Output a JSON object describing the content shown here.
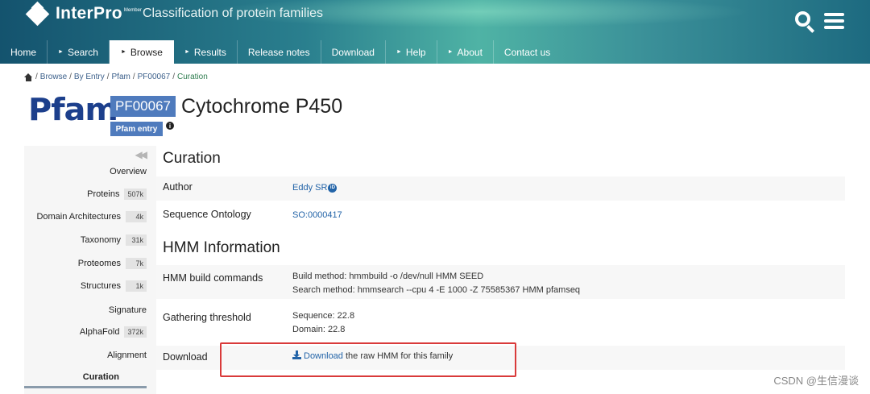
{
  "header": {
    "brand": "InterPro",
    "member_label": "Member",
    "subtitle": "Classification of protein families",
    "nav": [
      {
        "label": "Home",
        "arrow": false,
        "active": false
      },
      {
        "label": "Search",
        "arrow": true,
        "active": false
      },
      {
        "label": "Browse",
        "arrow": true,
        "active": true
      },
      {
        "label": "Results",
        "arrow": true,
        "active": false
      },
      {
        "label": "Release notes",
        "arrow": false,
        "active": false
      },
      {
        "label": "Download",
        "arrow": false,
        "active": false
      },
      {
        "label": "Help",
        "arrow": true,
        "active": false
      },
      {
        "label": "About",
        "arrow": true,
        "active": false
      },
      {
        "label": "Contact us",
        "arrow": false,
        "active": false
      }
    ],
    "icons": [
      "search-icon",
      "menu-icon"
    ]
  },
  "breadcrumb": {
    "items": [
      "Browse",
      "By Entry",
      "Pfam",
      "PF00067"
    ],
    "current": "Curation",
    "separator": "/"
  },
  "entry": {
    "db_logo": "Pfam",
    "accession": "PF00067",
    "title": "Cytochrome P450",
    "type_badge": "Pfam entry"
  },
  "sidebar": {
    "items": [
      {
        "label": "Overview",
        "count": ""
      },
      {
        "label": "Proteins",
        "count": "507k"
      },
      {
        "label": "Domain Architectures",
        "count": "4k"
      },
      {
        "label": "Taxonomy",
        "count": "31k"
      },
      {
        "label": "Proteomes",
        "count": "7k"
      },
      {
        "label": "Structures",
        "count": "1k"
      },
      {
        "label": "Signature",
        "count": ""
      },
      {
        "label": "AlphaFold",
        "count": "372k"
      },
      {
        "label": "Alignment",
        "count": ""
      },
      {
        "label": "Curation",
        "count": ""
      }
    ],
    "active": "Curation"
  },
  "curation": {
    "title": "Curation",
    "author_label": "Author",
    "author_value": "Eddy SR",
    "orcid_badge": "iD",
    "so_label": "Sequence Ontology",
    "so_value": "SO:0000417"
  },
  "hmm": {
    "title": "HMM Information",
    "build_label": "HMM build commands",
    "build_method": "Build method: hmmbuild -o /dev/null HMM SEED",
    "search_method": "Search method: hmmsearch --cpu 4 -E 1000 -Z 75585367 HMM pfamseq",
    "threshold_label": "Gathering threshold",
    "threshold_sequence": "Sequence: 22.8",
    "threshold_domain": "Domain: 22.8",
    "download_label": "Download",
    "download_link": "Download",
    "download_text": " the raw HMM for this family"
  },
  "watermark": "CSDN @生信漫谈",
  "colors": {
    "accent": "#4f7bbd",
    "link": "#2364a8",
    "highlight": "#d93a3a"
  }
}
